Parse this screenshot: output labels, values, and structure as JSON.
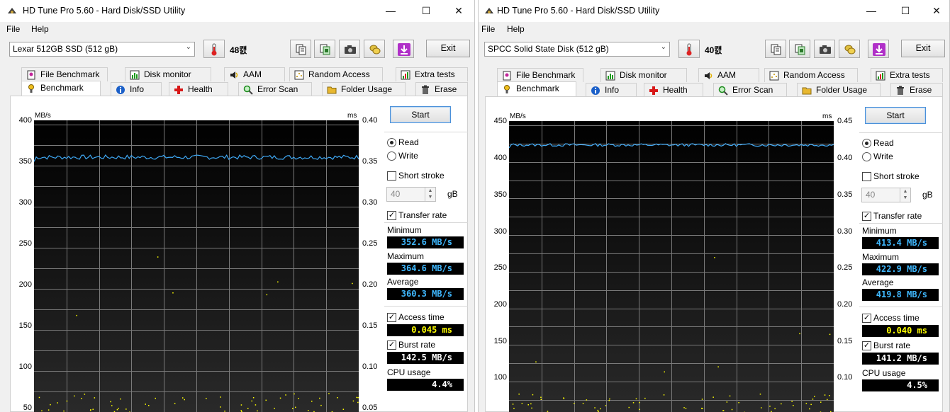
{
  "windows": [
    {
      "title": "HD Tune Pro 5.60 - Hard Disk/SSD Utility",
      "menu": {
        "file": "File",
        "help": "Help"
      },
      "drive": "Lexar 512GB SSD (512 gB)",
      "temperature": "48캜",
      "exit_label": "Exit",
      "tabs_top": [
        "File Benchmark",
        "Disk monitor",
        "AAM",
        "Random Access",
        "Extra tests"
      ],
      "tabs_bottom": [
        "Benchmark",
        "Info",
        "Health",
        "Error Scan",
        "Folder Usage",
        "Erase"
      ],
      "graph": {
        "unit_left": "MB/s",
        "unit_right": "ms",
        "y_left": [
          "400",
          "350",
          "300",
          "250",
          "200",
          "150",
          "100",
          "50"
        ],
        "y_right": [
          "0.40",
          "0.35",
          "0.30",
          "0.25",
          "0.20",
          "0.15",
          "0.10",
          "0.05"
        ],
        "y_max": 400,
        "transfer_avg": 360.3,
        "transfer_min": 352.6,
        "transfer_max": 364.6
      },
      "start_label": "Start",
      "read_label": "Read",
      "write_label": "Write",
      "short_stroke_label": "Short stroke",
      "short_stroke_value": "40",
      "short_stroke_unit": "gB",
      "transfer_rate_label": "Transfer rate",
      "minimum_label": "Minimum",
      "minimum": "352.6 MB/s",
      "maximum_label": "Maximum",
      "maximum": "364.6 MB/s",
      "average_label": "Average",
      "average": "360.3 MB/s",
      "access_time_label": "Access time",
      "access_time": "0.045 ms",
      "burst_rate_label": "Burst rate",
      "burst_rate": "142.5 MB/s",
      "cpu_usage_label": "CPU usage",
      "cpu_usage": "4.4%"
    },
    {
      "title": "HD Tune Pro 5.60 - Hard Disk/SSD Utility",
      "menu": {
        "file": "File",
        "help": "Help"
      },
      "drive": "SPCC Solid State Disk (512 gB)",
      "temperature": "40캜",
      "exit_label": "Exit",
      "tabs_top": [
        "File Benchmark",
        "Disk monitor",
        "AAM",
        "Random Access",
        "Extra tests"
      ],
      "tabs_bottom": [
        "Benchmark",
        "Info",
        "Health",
        "Error Scan",
        "Folder Usage",
        "Erase"
      ],
      "graph": {
        "unit_left": "MB/s",
        "unit_right": "ms",
        "y_left": [
          "450",
          "400",
          "350",
          "300",
          "250",
          "200",
          "150",
          "100"
        ],
        "y_right": [
          "0.45",
          "0.40",
          "0.35",
          "0.30",
          "0.25",
          "0.20",
          "0.15",
          "0.10"
        ],
        "y_max": 450,
        "transfer_avg": 419.8,
        "transfer_min": 413.4,
        "transfer_max": 422.9
      },
      "start_label": "Start",
      "read_label": "Read",
      "write_label": "Write",
      "short_stroke_label": "Short stroke",
      "short_stroke_value": "40",
      "short_stroke_unit": "gB",
      "transfer_rate_label": "Transfer rate",
      "minimum_label": "Minimum",
      "minimum": "413.4 MB/s",
      "maximum_label": "Maximum",
      "maximum": "422.9 MB/s",
      "average_label": "Average",
      "average": "419.8 MB/s",
      "access_time_label": "Access time",
      "access_time": "0.040 ms",
      "burst_rate_label": "Burst rate",
      "burst_rate": "141.2 MB/s",
      "cpu_usage_label": "CPU usage",
      "cpu_usage": "4.5%"
    }
  ],
  "colors": {
    "transfer_line": "#3fa9f5",
    "access_dots": "#ffff00",
    "value_blue": "#3fb8ff",
    "graph_bg": "#000000",
    "grid": "#7a7a7a"
  },
  "icons": [
    "app-icon",
    "thermometer-icon",
    "copy-icon",
    "copy-green-icon",
    "camera-icon",
    "coins-icon",
    "download-icon"
  ]
}
